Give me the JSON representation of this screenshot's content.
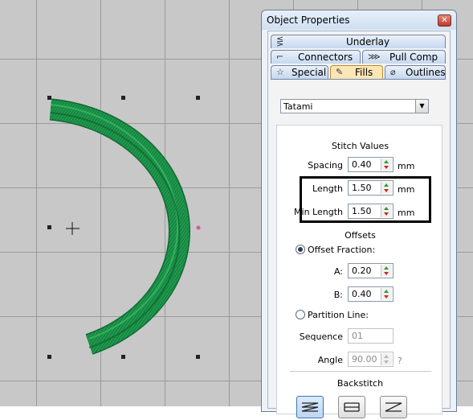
{
  "window": {
    "title": "Object Properties",
    "close_glyph": "✕"
  },
  "tabs": {
    "underlay": {
      "label": "Underlay",
      "icon": "underlay-icon"
    },
    "connectors": {
      "label": "Connectors",
      "icon": "connectors-icon"
    },
    "pull_comp": {
      "label": "Pull Comp",
      "icon": "pull-comp-icon"
    },
    "special": {
      "label": "Special",
      "icon": "star-icon"
    },
    "fills": {
      "label": "Fills",
      "icon": "paint-bucket-icon",
      "active": true
    },
    "outlines": {
      "label": "Outlines",
      "icon": "outlines-icon"
    }
  },
  "fill_type": {
    "value": "Tatami"
  },
  "stitch_values": {
    "heading": "Stitch Values",
    "spacing": {
      "label": "Spacing",
      "value": "0.40",
      "unit": "mm"
    },
    "length": {
      "label": "Length",
      "value": "1.50",
      "unit": "mm"
    },
    "min_length": {
      "label": "Min Length",
      "value": "1.50",
      "unit": "mm"
    }
  },
  "offsets": {
    "heading": "Offsets",
    "offset_fraction": {
      "label": "Offset Fraction:",
      "selected": true
    },
    "a": {
      "label": "A:",
      "value": "0.20"
    },
    "b": {
      "label": "B:",
      "value": "0.40"
    },
    "partition_line": {
      "label": "Partition Line:",
      "selected": false
    },
    "sequence": {
      "label": "Sequence",
      "value": "01"
    },
    "angle": {
      "label": "Angle",
      "value": "90.00",
      "suffix": "?"
    }
  },
  "backstitch": {
    "heading": "Backstitch"
  },
  "colors": {
    "stitch_green": "#1f9a4e",
    "canvas_bg": "#c8c8c8",
    "highlight": "#000000"
  }
}
